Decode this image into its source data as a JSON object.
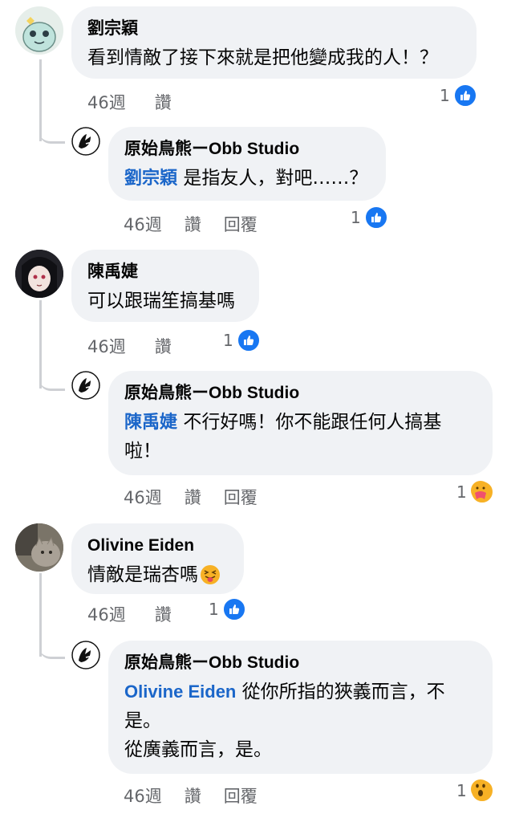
{
  "comments": [
    {
      "author": "劉宗穎",
      "text": "看到情敵了接下來就是把他變成我的人！？",
      "time": "46週",
      "like_label": "讚",
      "reaction_count": "1"
    },
    {
      "author": "原始鳥熊ーObb Studio",
      "mention": "劉宗穎",
      "text": " 是指友人，對吧……？",
      "time": "46週",
      "like_label": "讚",
      "reply_label": "回覆",
      "reaction_count": "1"
    },
    {
      "author": "陳禹婕",
      "text": "可以跟瑞笙搞基嗎",
      "time": "46週",
      "like_label": "讚",
      "reaction_count": "1"
    },
    {
      "author": "原始鳥熊ーObb Studio",
      "mention": "陳禹婕",
      "text": " 不行好嗎！你不能跟任何人搞基",
      "text2": "啦！",
      "time": "46週",
      "like_label": "讚",
      "reply_label": "回覆",
      "reaction_count": "1"
    },
    {
      "author": "Olivine Eiden",
      "text": "情敵是瑞杏嗎",
      "time": "46週",
      "like_label": "讚",
      "reaction_count": "1"
    },
    {
      "author": "原始鳥熊ーObb Studio",
      "mention": "Olivine Eiden",
      "text": " 從你所指的狹義而言，不",
      "text2": "是。",
      "text3": "從廣義而言，是。",
      "time": "46週",
      "like_label": "讚",
      "reply_label": "回覆",
      "reaction_count": "1"
    }
  ],
  "colors": {
    "bubble": "#f0f2f5",
    "mention": "#1b66c9",
    "meta": "#65676b",
    "like": "#1877f2"
  }
}
